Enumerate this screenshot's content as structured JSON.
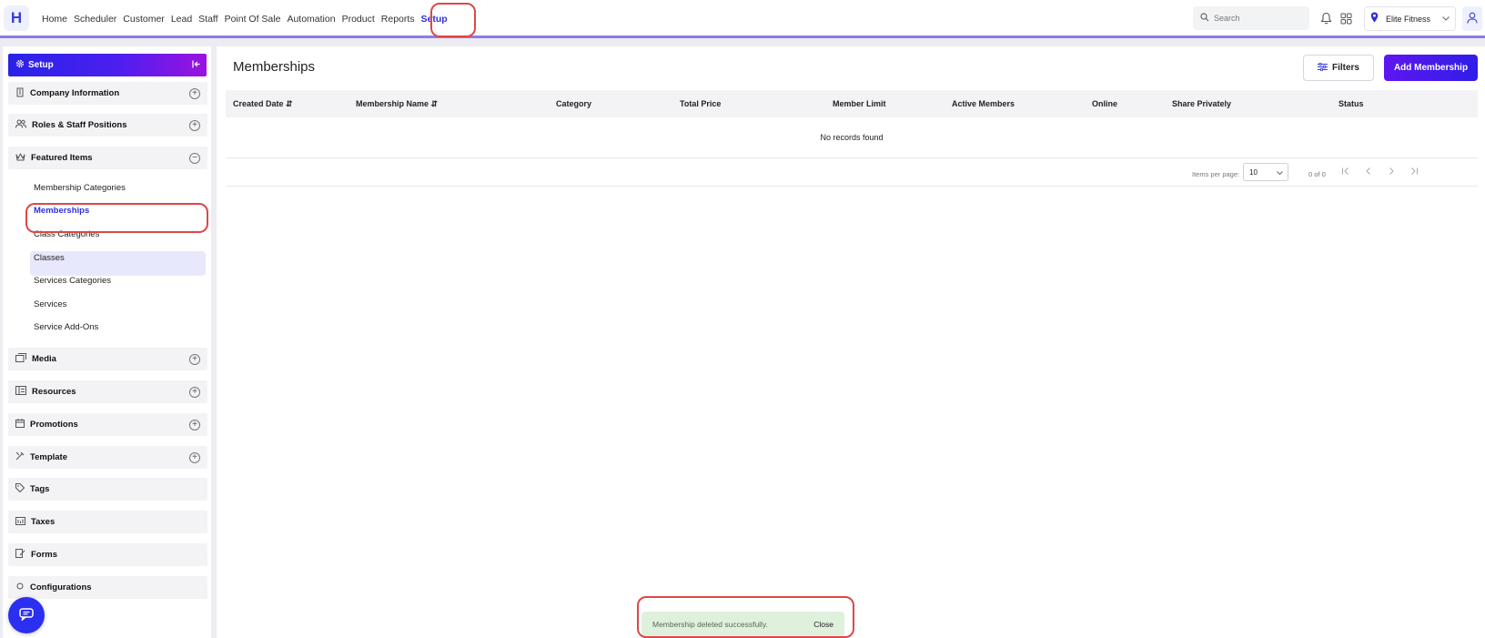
{
  "app": {
    "logo_letter": "H"
  },
  "nav": {
    "items": [
      "Home",
      "Scheduler",
      "Customer",
      "Lead",
      "Staff",
      "Point Of Sale",
      "Automation",
      "Product",
      "Reports",
      "Setup"
    ],
    "active": "Setup"
  },
  "header": {
    "search_placeholder": "Search",
    "location": "Elite Fitness"
  },
  "sidebar": {
    "title": "Setup",
    "groups": {
      "company": "Company Information",
      "roles": "Roles & Staff Positions",
      "featured": "Featured Items",
      "media": "Media",
      "resources": "Resources",
      "promotions": "Promotions",
      "template": "Template",
      "tags": "Tags",
      "taxes": "Taxes",
      "forms": "Forms",
      "configurations": "Configurations"
    },
    "featured_items": [
      "Membership Categories",
      "Memberships",
      "Class Categories",
      "Classes",
      "Services Categories",
      "Services",
      "Service Add-Ons"
    ],
    "active_item": "Memberships"
  },
  "main": {
    "title": "Memberships",
    "filters_label": "Filters",
    "add_label": "Add Membership",
    "columns": {
      "created": "Created Date",
      "name": "Membership Name",
      "category": "Category",
      "price": "Total Price",
      "limit": "Member Limit",
      "active": "Active Members",
      "online": "Online",
      "share": "Share Privately",
      "status": "Status"
    },
    "empty_text": "No records found",
    "pagination": {
      "items_per_page_label": "Items per page:",
      "items_per_page": "10",
      "range": "0 of 0"
    }
  },
  "toast": {
    "message": "Membership deleted successfully.",
    "close_label": "Close"
  },
  "colors": {
    "accent": "#2d2ee0",
    "gradient_start": "#2a22e8",
    "gradient_end": "#9c12e0",
    "highlight": "#de4747",
    "toast_bg": "#dff1dd"
  }
}
